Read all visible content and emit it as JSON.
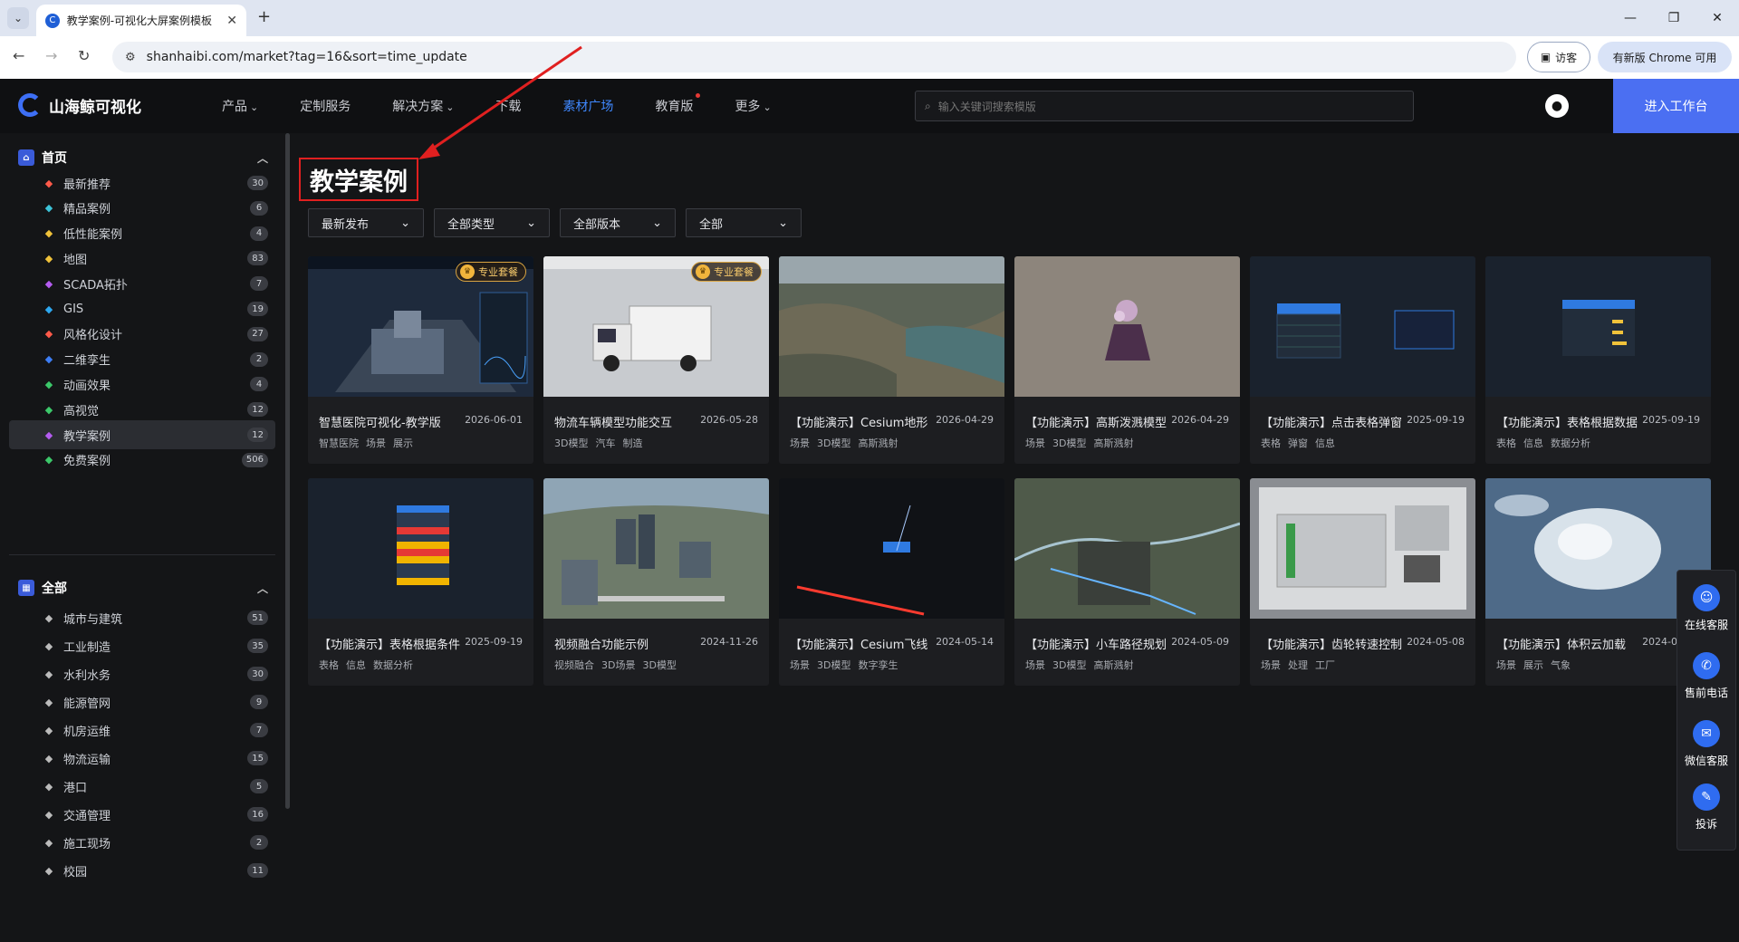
{
  "browser": {
    "tab_title": "教学案例-可视化大屏案例模板",
    "url": "shanhaibi.com/market?tag=16&sort=time_update",
    "guest_label": "访客",
    "update_label": "有新版 Chrome 可用"
  },
  "site": {
    "brand": "山海鲸可视化",
    "nav": [
      {
        "label": "产品",
        "caret": "⌄"
      },
      {
        "label": "定制服务",
        "caret": ""
      },
      {
        "label": "解决方案",
        "caret": "⌄"
      },
      {
        "label": "下载",
        "caret": ""
      },
      {
        "label": "素材广场",
        "caret": ""
      },
      {
        "label": "教育版",
        "caret": ""
      },
      {
        "label": "更多",
        "caret": "⌄"
      }
    ],
    "search_placeholder": "输入关键词搜索模版",
    "enter_button": "进入工作台"
  },
  "sidebar": {
    "home_label": "首页",
    "home_items": [
      {
        "label": "最新推荐",
        "count": "30",
        "icon": "fire-icon",
        "color": "#ff5a4a"
      },
      {
        "label": "精品案例",
        "count": "6",
        "icon": "screen-icon",
        "color": "#3cc3d8"
      },
      {
        "label": "低性能案例",
        "count": "4",
        "icon": "gauge-icon",
        "color": "#f0c23a"
      },
      {
        "label": "地图",
        "count": "83",
        "icon": "map-icon",
        "color": "#f0c23a"
      },
      {
        "label": "SCADA拓扑",
        "count": "7",
        "icon": "cube-icon",
        "color": "#b45cf0"
      },
      {
        "label": "GIS",
        "count": "19",
        "icon": "globe-icon",
        "color": "#2ea8f0"
      },
      {
        "label": "风格化设计",
        "count": "27",
        "icon": "lock-icon",
        "color": "#ff5a4a"
      },
      {
        "label": "二维孪生",
        "count": "2",
        "icon": "twin-icon",
        "color": "#3d7ef5"
      },
      {
        "label": "动画效果",
        "count": "4",
        "icon": "star-icon",
        "color": "#3cc86a"
      },
      {
        "label": "高视觉",
        "count": "12",
        "icon": "eye-icon",
        "color": "#3cc86a"
      },
      {
        "label": "教学案例",
        "count": "12",
        "icon": "book-icon",
        "color": "#b45cf0"
      },
      {
        "label": "免费案例",
        "count": "506",
        "icon": "free-icon",
        "color": "#3cc86a"
      }
    ],
    "all_label": "全部",
    "all_items": [
      {
        "label": "城市与建筑",
        "count": "51",
        "icon": "building-icon"
      },
      {
        "label": "工业制造",
        "count": "35",
        "icon": "factory-icon"
      },
      {
        "label": "水利水务",
        "count": "30",
        "icon": "water-icon"
      },
      {
        "label": "能源管网",
        "count": "9",
        "icon": "energy-icon"
      },
      {
        "label": "机房运维",
        "count": "7",
        "icon": "server-icon"
      },
      {
        "label": "物流运输",
        "count": "15",
        "icon": "truck-icon"
      },
      {
        "label": "港口",
        "count": "5",
        "icon": "port-icon"
      },
      {
        "label": "交通管理",
        "count": "16",
        "icon": "bus-icon"
      },
      {
        "label": "施工现场",
        "count": "2",
        "icon": "construction-icon"
      },
      {
        "label": "校园",
        "count": "11",
        "icon": "campus-icon"
      }
    ]
  },
  "page": {
    "title": "教学案例",
    "filters": [
      "最新发布",
      "全部类型",
      "全部版本",
      "全部"
    ]
  },
  "cards": [
    {
      "title": "智慧医院可视化-教学版",
      "date": "2026-06-01",
      "tags": [
        "智慧医院",
        "场景",
        "展示"
      ],
      "badge": "专业套餐",
      "thumb": "hospital"
    },
    {
      "title": "物流车辆模型功能交互",
      "date": "2026-05-28",
      "tags": [
        "3D模型",
        "汽车",
        "制造"
      ],
      "badge": "专业套餐",
      "thumb": "truck"
    },
    {
      "title": "【功能演示】Cesium地形",
      "date": "2026-04-29",
      "tags": [
        "场景",
        "3D模型",
        "高斯溅射"
      ],
      "badge": "",
      "thumb": "terrain"
    },
    {
      "title": "【功能演示】高斯泼溅模型",
      "date": "2026-04-29",
      "tags": [
        "场景",
        "3D模型",
        "高斯溅射"
      ],
      "badge": "",
      "thumb": "gauss"
    },
    {
      "title": "【功能演示】点击表格弹窗",
      "date": "2025-09-19",
      "tags": [
        "表格",
        "弹窗",
        "信息"
      ],
      "badge": "",
      "thumb": "table1"
    },
    {
      "title": "【功能演示】表格根据数据",
      "date": "2025-09-19",
      "tags": [
        "表格",
        "信息",
        "数据分析"
      ],
      "badge": "",
      "thumb": "table2"
    },
    {
      "title": "【功能演示】表格根据条件",
      "date": "2025-09-19",
      "tags": [
        "表格",
        "信息",
        "数据分析"
      ],
      "badge": "",
      "thumb": "table3"
    },
    {
      "title": "视频融合功能示例",
      "date": "2024-11-26",
      "tags": [
        "视频融合",
        "3D场景",
        "3D模型"
      ],
      "badge": "",
      "thumb": "city"
    },
    {
      "title": "【功能演示】Cesium飞线",
      "date": "2024-05-14",
      "tags": [
        "场景",
        "3D模型",
        "数字孪生"
      ],
      "badge": "",
      "thumb": "night"
    },
    {
      "title": "【功能演示】小车路径规划",
      "date": "2024-05-09",
      "tags": [
        "场景",
        "3D模型",
        "高斯溅射"
      ],
      "badge": "",
      "thumb": "aerial"
    },
    {
      "title": "【功能演示】齿轮转速控制",
      "date": "2024-05-08",
      "tags": [
        "场景",
        "处理",
        "工厂"
      ],
      "badge": "",
      "thumb": "factory"
    },
    {
      "title": "【功能演示】体积云加载",
      "date": "2024-05-08",
      "tags": [
        "场景",
        "展示",
        "气象"
      ],
      "badge": "",
      "thumb": "cloud"
    }
  ],
  "float_bar": [
    {
      "label": "在线客服",
      "icon": "headset-icon",
      "glyph": "☺"
    },
    {
      "label": "售前电话",
      "icon": "phone-icon",
      "glyph": "✆"
    },
    {
      "label": "微信客服",
      "icon": "wechat-icon",
      "glyph": "✉"
    },
    {
      "label": "投诉",
      "icon": "complaint-icon",
      "glyph": "✎"
    }
  ]
}
